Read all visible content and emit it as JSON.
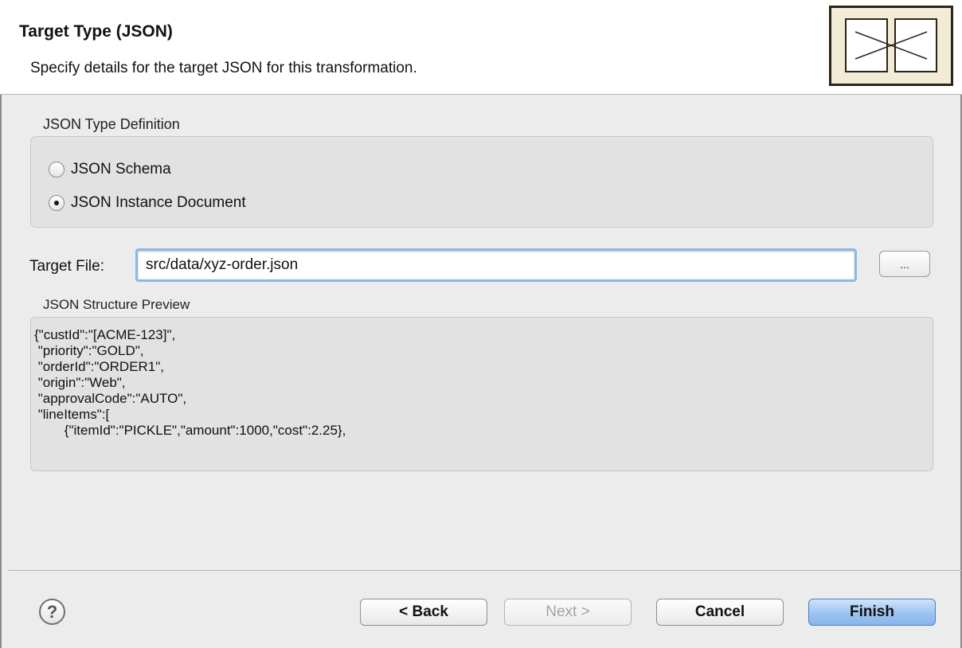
{
  "header": {
    "title": "Target Type (JSON)",
    "subtitle": "Specify details for the target JSON for this transformation."
  },
  "type_definition": {
    "label": "JSON Type Definition",
    "options": [
      {
        "label": "JSON Schema",
        "selected": false
      },
      {
        "label": "JSON Instance Document",
        "selected": true
      }
    ]
  },
  "target_file": {
    "label": "Target File:",
    "value": "src/data/xyz-order.json",
    "browse_label": "..."
  },
  "preview": {
    "label": "JSON Structure Preview",
    "content": "{\"custId\":\"[ACME-123]\",\n \"priority\":\"GOLD\",\n \"orderId\":\"ORDER1\",\n \"origin\":\"Web\",\n \"approvalCode\":\"AUTO\",\n \"lineItems\":[\n        {\"itemId\":\"PICKLE\",\"amount\":1000,\"cost\":2.25},"
  },
  "footer": {
    "help_label": "?",
    "back_label": "< Back",
    "next_label": "Next >",
    "cancel_label": "Cancel",
    "finish_label": "Finish"
  },
  "colors": {
    "accent": "#8fb6e8",
    "primary_button": "#9cc3f0",
    "panel": "#e2e2e2"
  },
  "icons": {
    "banner": "wizard-banner-icon",
    "help": "help-icon"
  }
}
